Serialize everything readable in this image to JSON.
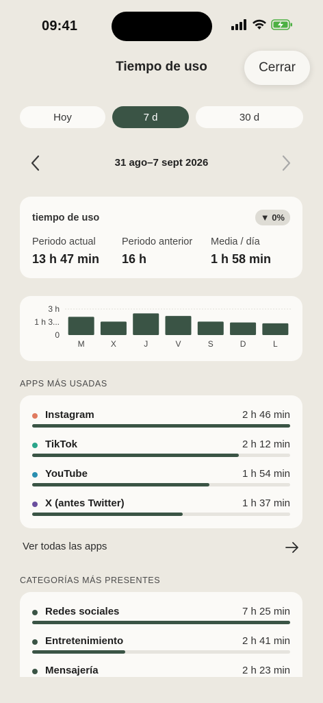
{
  "status": {
    "time": "09:41"
  },
  "nav": {
    "title": "Tiempo de uso",
    "close_label": "Cerrar"
  },
  "tabs": [
    {
      "label": "Hoy",
      "selected": false
    },
    {
      "label": "7 d",
      "selected": true
    },
    {
      "label": "30 d",
      "selected": false
    }
  ],
  "date_range": "31 ago–7 sept 2026",
  "summary": {
    "title": "tiempo de uso",
    "change_badge": "▼ 0%",
    "stats": [
      {
        "label": "Periodo actual",
        "value": "13 h 47 min"
      },
      {
        "label": "Periodo anterior",
        "value": "16 h"
      },
      {
        "label": "Media / día",
        "value": "1 h 58 min"
      }
    ]
  },
  "chart_data": {
    "type": "bar",
    "categories": [
      "M",
      "X",
      "J",
      "V",
      "S",
      "D",
      "L"
    ],
    "values": [
      2.1,
      1.55,
      2.5,
      2.2,
      1.55,
      1.45,
      1.35
    ],
    "ytick_labels": [
      "3 h",
      "1 h 3...",
      "0"
    ],
    "ytick_values": [
      3,
      1.5,
      0
    ],
    "ylim": [
      0,
      3
    ],
    "bar_color": "#3a5445"
  },
  "apps_section": {
    "heading": "APPS MÁS USADAS",
    "items": [
      {
        "name": "Instagram",
        "duration": "2 h 46 min",
        "fraction": 1.0,
        "color": "#e07a5f"
      },
      {
        "name": "TikTok",
        "duration": "2 h 12 min",
        "fraction": 0.8,
        "color": "#2aa58a"
      },
      {
        "name": "YouTube",
        "duration": "1 h 54 min",
        "fraction": 0.687,
        "color": "#2a8fb0"
      },
      {
        "name": "X (antes Twitter)",
        "duration": "1 h 37 min",
        "fraction": 0.584,
        "color": "#6a4f9e"
      }
    ],
    "see_all_label": "Ver todas las apps"
  },
  "categories_section": {
    "heading": "CATEGORÍAS MÁS PRESENTES",
    "items": [
      {
        "name": "Redes sociales",
        "duration": "7 h 25 min",
        "fraction": 1.0,
        "color": "#3a5445"
      },
      {
        "name": "Entretenimiento",
        "duration": "2 h 41 min",
        "fraction": 0.362,
        "color": "#3a5445"
      },
      {
        "name": "Mensajería",
        "duration": "2 h 23 min",
        "fraction": 0.321,
        "color": "#3a5445"
      }
    ]
  },
  "colors": {
    "accent": "#3a5445",
    "background": "#ece9e1",
    "card": "#fbfaf7"
  }
}
